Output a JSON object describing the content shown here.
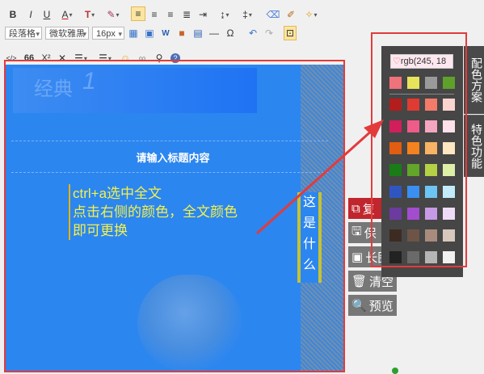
{
  "toolbar": {
    "bold": "B",
    "italic": "I",
    "underline": "U",
    "font_color": "A",
    "paragraph_select": "段落格",
    "font_select": "微软雅黑",
    "size_select": "16px",
    "omega": "Ω",
    "superscript": "X²",
    "subscript": "X₂",
    "quote": "66"
  },
  "editor": {
    "header_title": "经典",
    "header_number": "1",
    "title_placeholder": "请输入标题内容",
    "instruction_line1": "ctrl+a选中全文",
    "instruction_line2": "点击右侧的颜色，全文颜色",
    "instruction_line3": "即可更换",
    "vertical_text": [
      "这",
      "是",
      "什",
      "么"
    ]
  },
  "side_buttons": [
    {
      "label": "复",
      "icon": "copy-icon",
      "active": true
    },
    {
      "label": "保",
      "icon": "save-icon",
      "active": false
    },
    {
      "label": "长图",
      "icon": "image-icon",
      "active": false
    },
    {
      "label": "清空",
      "icon": "trash-icon",
      "active": false
    },
    {
      "label": "预览",
      "icon": "search-icon",
      "active": false
    }
  ],
  "color_picker": {
    "input_value": "rgb(245, 18",
    "preset_row": [
      "#f0727b",
      "#e7e35a",
      "#9a9a9a",
      "#5fa02a"
    ],
    "grid": [
      [
        "#b31d1d",
        "#e03b32",
        "#f47a6a",
        "#fbd4cf"
      ],
      [
        "#d01f5b",
        "#ee5c89",
        "#f5a6c0",
        "#fde0ea"
      ],
      [
        "#e15d11",
        "#f4821e",
        "#f7b464",
        "#fde6c2"
      ],
      [
        "#197c17",
        "#62a62a",
        "#b4d243",
        "#def0a6"
      ],
      [
        "#2f56c0",
        "#3a8ff0",
        "#6cc5f4",
        "#c3ecfb"
      ],
      [
        "#6b3ba0",
        "#a24dd0",
        "#c79ae6",
        "#eedcf7"
      ],
      [
        "#3d2b22",
        "#6d5446",
        "#a88b7c",
        "#d8c7bd"
      ],
      [
        "#222222",
        "#6a6a6a",
        "#b5b5b5",
        "#f1f1f1"
      ]
    ]
  },
  "vertical_tabs": [
    "配色方案",
    "特色功能"
  ],
  "colors": {
    "editor_bg": "#2b86f0",
    "accent_yellow": "#f5f04a",
    "annotation_red": "#e33b3b",
    "popup_bg": "#464646"
  }
}
